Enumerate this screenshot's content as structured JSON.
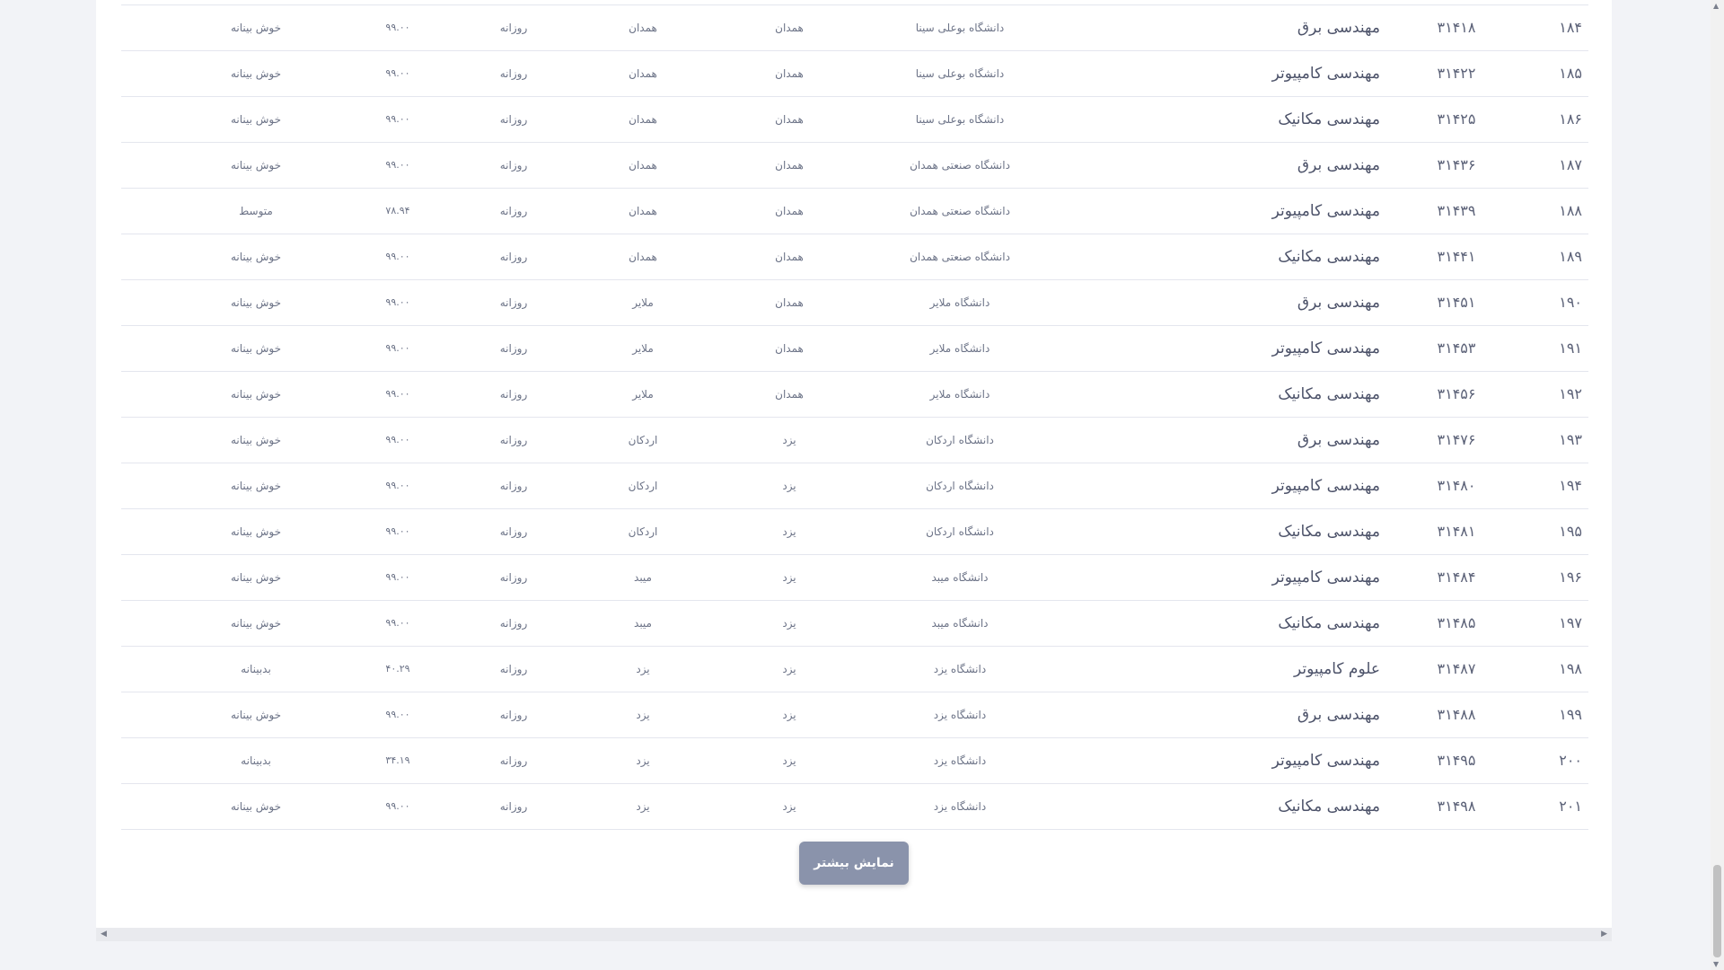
{
  "table": {
    "rows": [
      {
        "idx": "۱۸۴",
        "code": "۳۱۴۱۸",
        "field": "مهندسی برق",
        "university": "دانشگاه بوعلی سینا",
        "province": "همدان",
        "city": "همدان",
        "mode": "روزانه",
        "score": "۹۹.۰۰",
        "status": "خوش بینانه"
      },
      {
        "idx": "۱۸۵",
        "code": "۳۱۴۲۲",
        "field": "مهندسی کامپیوتر",
        "university": "دانشگاه بوعلی سینا",
        "province": "همدان",
        "city": "همدان",
        "mode": "روزانه",
        "score": "۹۹.۰۰",
        "status": "خوش بینانه"
      },
      {
        "idx": "۱۸۶",
        "code": "۳۱۴۲۵",
        "field": "مهندسی مکانیک",
        "university": "دانشگاه بوعلی سینا",
        "province": "همدان",
        "city": "همدان",
        "mode": "روزانه",
        "score": "۹۹.۰۰",
        "status": "خوش بینانه"
      },
      {
        "idx": "۱۸۷",
        "code": "۳۱۴۳۶",
        "field": "مهندسی برق",
        "university": "دانشگاه صنعتی همدان",
        "province": "همدان",
        "city": "همدان",
        "mode": "روزانه",
        "score": "۹۹.۰۰",
        "status": "خوش بینانه"
      },
      {
        "idx": "۱۸۸",
        "code": "۳۱۴۳۹",
        "field": "مهندسی کامپیوتر",
        "university": "دانشگاه صنعتی همدان",
        "province": "همدان",
        "city": "همدان",
        "mode": "روزانه",
        "score": "۷۸.۹۴",
        "status": "متوسط"
      },
      {
        "idx": "۱۸۹",
        "code": "۳۱۴۴۱",
        "field": "مهندسی مکانیک",
        "university": "دانشگاه صنعتی همدان",
        "province": "همدان",
        "city": "همدان",
        "mode": "روزانه",
        "score": "۹۹.۰۰",
        "status": "خوش بینانه"
      },
      {
        "idx": "۱۹۰",
        "code": "۳۱۴۵۱",
        "field": "مهندسی برق",
        "university": "دانشگاه ملایر",
        "province": "همدان",
        "city": "ملایر",
        "mode": "روزانه",
        "score": "۹۹.۰۰",
        "status": "خوش بینانه"
      },
      {
        "idx": "۱۹۱",
        "code": "۳۱۴۵۳",
        "field": "مهندسی کامپیوتر",
        "university": "دانشگاه ملایر",
        "province": "همدان",
        "city": "ملایر",
        "mode": "روزانه",
        "score": "۹۹.۰۰",
        "status": "خوش بینانه"
      },
      {
        "idx": "۱۹۲",
        "code": "۳۱۴۵۶",
        "field": "مهندسی مکانیک",
        "university": "دانشگاه ملایر",
        "province": "همدان",
        "city": "ملایر",
        "mode": "روزانه",
        "score": "۹۹.۰۰",
        "status": "خوش بینانه"
      },
      {
        "idx": "۱۹۳",
        "code": "۳۱۴۷۶",
        "field": "مهندسی برق",
        "university": "دانشگاه اردکان",
        "province": "یزد",
        "city": "اردکان",
        "mode": "روزانه",
        "score": "۹۹.۰۰",
        "status": "خوش بینانه"
      },
      {
        "idx": "۱۹۴",
        "code": "۳۱۴۸۰",
        "field": "مهندسی کامپیوتر",
        "university": "دانشگاه اردکان",
        "province": "یزد",
        "city": "اردکان",
        "mode": "روزانه",
        "score": "۹۹.۰۰",
        "status": "خوش بینانه"
      },
      {
        "idx": "۱۹۵",
        "code": "۳۱۴۸۱",
        "field": "مهندسی مکانیک",
        "university": "دانشگاه اردکان",
        "province": "یزد",
        "city": "اردکان",
        "mode": "روزانه",
        "score": "۹۹.۰۰",
        "status": "خوش بینانه"
      },
      {
        "idx": "۱۹۶",
        "code": "۳۱۴۸۴",
        "field": "مهندسی کامپیوتر",
        "university": "دانشگاه میبد",
        "province": "یزد",
        "city": "میبد",
        "mode": "روزانه",
        "score": "۹۹.۰۰",
        "status": "خوش بینانه"
      },
      {
        "idx": "۱۹۷",
        "code": "۳۱۴۸۵",
        "field": "مهندسی مکانیک",
        "university": "دانشگاه میبد",
        "province": "یزد",
        "city": "میبد",
        "mode": "روزانه",
        "score": "۹۹.۰۰",
        "status": "خوش بینانه"
      },
      {
        "idx": "۱۹۸",
        "code": "۳۱۴۸۷",
        "field": "علوم کامپیوتر",
        "university": "دانشگاه یزد",
        "province": "یزد",
        "city": "یزد",
        "mode": "روزانه",
        "score": "۴۰.۲۹",
        "status": "بدبینانه"
      },
      {
        "idx": "۱۹۹",
        "code": "۳۱۴۸۸",
        "field": "مهندسی برق",
        "university": "دانشگاه یزد",
        "province": "یزد",
        "city": "یزد",
        "mode": "روزانه",
        "score": "۹۹.۰۰",
        "status": "خوش بینانه"
      },
      {
        "idx": "۲۰۰",
        "code": "۳۱۴۹۵",
        "field": "مهندسی کامپیوتر",
        "university": "دانشگاه یزد",
        "province": "یزد",
        "city": "یزد",
        "mode": "روزانه",
        "score": "۳۴.۱۹",
        "status": "بدبینانه"
      },
      {
        "idx": "۲۰۱",
        "code": "۳۱۴۹۸",
        "field": "مهندسی مکانیک",
        "university": "دانشگاه یزد",
        "province": "یزد",
        "city": "یزد",
        "mode": "روزانه",
        "score": "۹۹.۰۰",
        "status": "خوش بینانه"
      }
    ]
  },
  "actions": {
    "show_more_label": "نمایش بیشتر"
  },
  "scrollbars": {
    "left_arrow": "◀",
    "right_arrow": "▶",
    "up_arrow": "▲",
    "down_arrow": "▼"
  }
}
